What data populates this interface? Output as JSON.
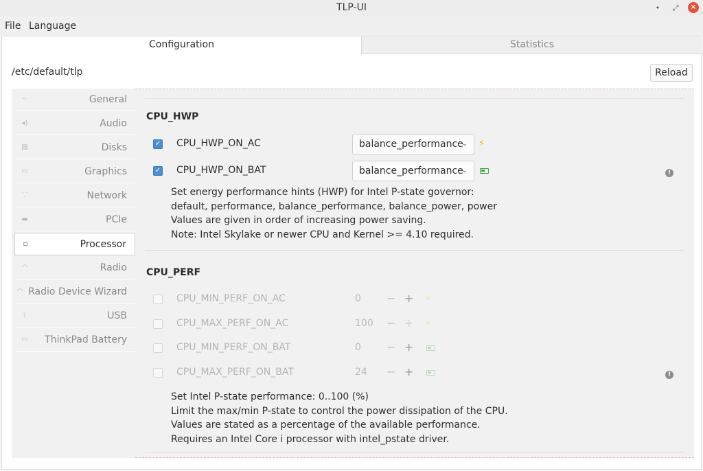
{
  "window": {
    "title": "TLP-UI",
    "minimize": "•",
    "maximize": "⤢",
    "close": "×"
  },
  "menubar": {
    "file": "File",
    "language": "Language"
  },
  "tabs": {
    "configuration": "Configuration",
    "statistics": "Statistics"
  },
  "path": "/etc/default/tlp",
  "reload_label": "Reload",
  "sidebar": {
    "items": [
      {
        "label": "General",
        "icon": "general-icon"
      },
      {
        "label": "Audio",
        "icon": "audio-icon"
      },
      {
        "label": "Disks",
        "icon": "disk-icon"
      },
      {
        "label": "Graphics",
        "icon": "display-icon"
      },
      {
        "label": "Network",
        "icon": "network-icon"
      },
      {
        "label": "PCIe",
        "icon": "pcie-icon"
      },
      {
        "label": "Processor",
        "icon": "processor-icon"
      },
      {
        "label": "Radio",
        "icon": "wifi-icon"
      },
      {
        "label": "Radio Device Wizard",
        "icon": "wifi-icon"
      },
      {
        "label": "USB",
        "icon": "usb-icon"
      },
      {
        "label": "ThinkPad Battery",
        "icon": "battery-icon"
      }
    ],
    "active": "Processor"
  },
  "sections": {
    "hwp": {
      "title": "CPU_HWP",
      "params": [
        {
          "name": "CPU_HWP_ON_AC",
          "enabled": true,
          "value": "balance_performance",
          "mode": "ac"
        },
        {
          "name": "CPU_HWP_ON_BAT",
          "enabled": true,
          "value": "balance_performance",
          "mode": "bat"
        }
      ],
      "desc": [
        "Set energy performance hints (HWP) for Intel P-state governor:",
        "default, performance, balance_performance, balance_power, power",
        "Values are given in order of increasing power saving.",
        "Note: Intel Skylake or newer CPU and Kernel >= 4.10 required."
      ]
    },
    "perf": {
      "title": "CPU_PERF",
      "params": [
        {
          "name": "CPU_MIN_PERF_ON_AC",
          "enabled": false,
          "value": "0",
          "mode": "ac"
        },
        {
          "name": "CPU_MAX_PERF_ON_AC",
          "enabled": false,
          "value": "100",
          "mode": "ac"
        },
        {
          "name": "CPU_MIN_PERF_ON_BAT",
          "enabled": false,
          "value": "0",
          "mode": "bat"
        },
        {
          "name": "CPU_MAX_PERF_ON_BAT",
          "enabled": false,
          "value": "24",
          "mode": "bat"
        }
      ],
      "desc": [
        "Set Intel P-state performance: 0..100 (%)",
        "Limit the max/min P-state to control the power dissipation of the CPU.",
        "Values are stated as a percentage of the available performance.",
        "Requires an Intel Core i processor with intel_pstate driver."
      ]
    }
  },
  "symbols": {
    "check": "✓",
    "chevron": "⌄",
    "bolt": "⚡",
    "minus": "−",
    "plus": "+",
    "info": "!"
  },
  "colors": {
    "accent": "#4a90d9",
    "bolt": "#e8b800",
    "battery": "#3aa83a"
  }
}
